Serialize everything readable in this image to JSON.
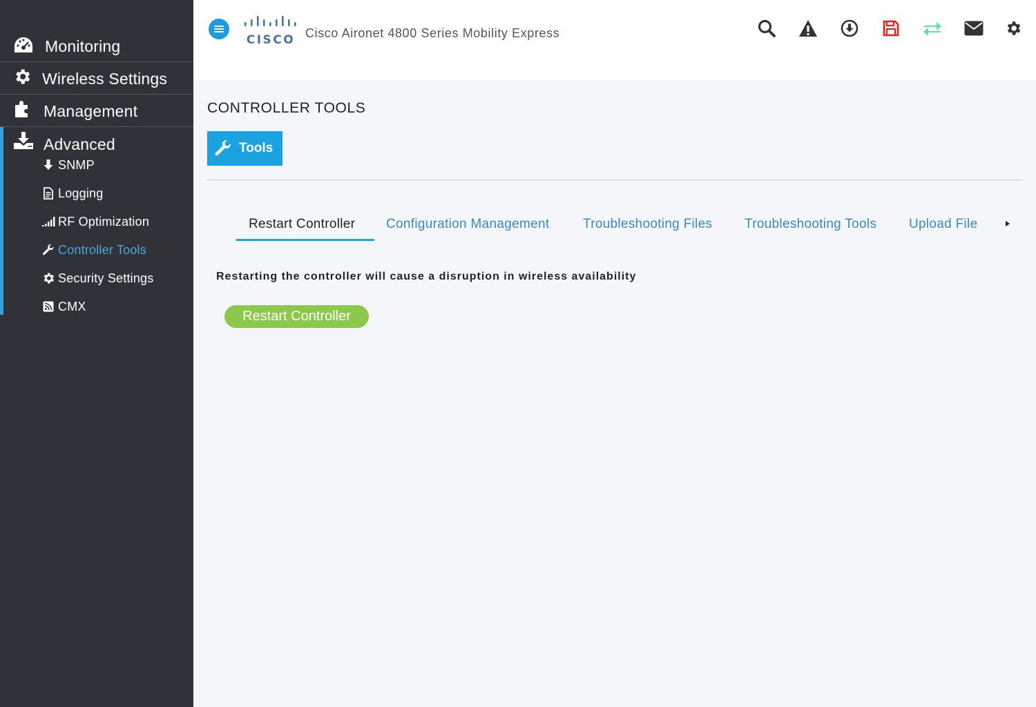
{
  "header": {
    "app_title": "Cisco Aironet 4800 Series Mobility Express",
    "logo_text": "CISCO",
    "icons": [
      "search-icon",
      "alert-icon",
      "download-icon",
      "save-icon",
      "sync-icon",
      "mail-icon",
      "gear-icon"
    ],
    "colors": {
      "menu": "#1c9ce0",
      "save": "#e2231a",
      "sync": "#5fe0b0",
      "default": "#333333"
    }
  },
  "sidebar": {
    "main_items": [
      {
        "label": "Monitoring",
        "icon": "dashboard-icon"
      },
      {
        "label": "Wireless Settings",
        "icon": "gear-icon"
      },
      {
        "label": "Management",
        "icon": "puzzle-icon"
      },
      {
        "label": "Advanced",
        "icon": "download-tray-icon"
      }
    ],
    "sub_items": [
      {
        "label": "SNMP",
        "icon": "arrow-down-icon"
      },
      {
        "label": "Logging",
        "icon": "file-icon"
      },
      {
        "label": "RF Optimization",
        "icon": "signal-icon"
      },
      {
        "label": "Controller Tools",
        "icon": "wrench-icon",
        "active": true
      },
      {
        "label": "Security Settings",
        "icon": "gear-icon"
      },
      {
        "label": "CMX",
        "icon": "rss-icon"
      }
    ],
    "active_color": "#4aa6dc"
  },
  "main": {
    "page_title": "CONTROLLER TOOLS",
    "tools_button": "Tools",
    "tabs": [
      {
        "label": "Restart Controller",
        "active": true
      },
      {
        "label": "Configuration Management"
      },
      {
        "label": "Troubleshooting Files"
      },
      {
        "label": "Troubleshooting Tools"
      },
      {
        "label": "Upload File"
      }
    ],
    "warning": "Restarting the controller will cause a disruption in wireless availability",
    "restart_button": "Restart Controller",
    "colors": {
      "accent": "#1ba2e0",
      "restart": "#8cc84b"
    }
  }
}
